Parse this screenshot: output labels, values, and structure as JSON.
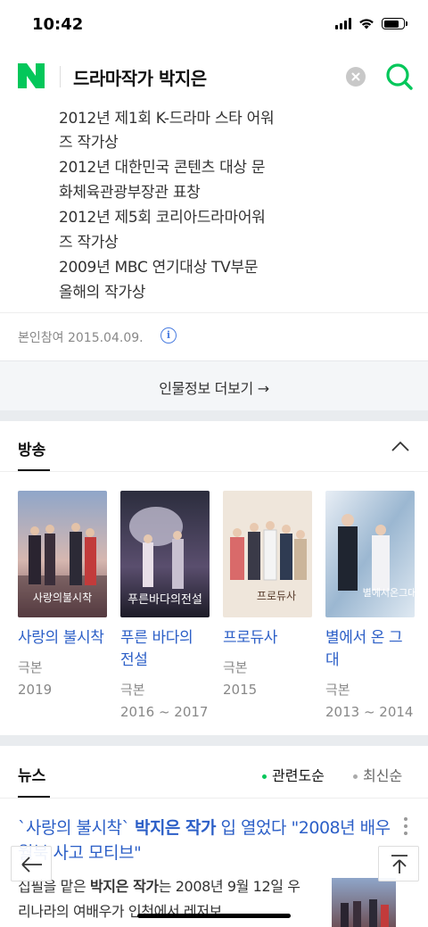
{
  "status": {
    "time": "10:42"
  },
  "search": {
    "query": "드라마작가 박지은"
  },
  "awards": [
    "2012년 제1회 K-드라마 스타 어워",
    "즈 작가상",
    "2012년 대한민국 콘텐츠 대상 문",
    "화체육관광부장관 표창",
    "2012년 제5회 코리아드라마어워",
    "즈 작가상",
    "2009년 MBC 연기대상 TV부문",
    "올해의 작가상"
  ],
  "reference": {
    "text": "본인참여 2015.04.09."
  },
  "more": {
    "label": "인물정보 더보기 →"
  },
  "broadcast": {
    "title": "방송",
    "dramas": [
      {
        "title": "사랑의 불시착",
        "role": "극본",
        "years": "2019"
      },
      {
        "title": "푸른 바다의 전설",
        "role": "극본",
        "years": "2016 ~ 2017"
      },
      {
        "title": "프로듀사",
        "role": "극본",
        "years": "2015"
      },
      {
        "title": "별에서 온 그대",
        "role": "극본",
        "years": "2013 ~ 2014"
      }
    ]
  },
  "news": {
    "title": "뉴스",
    "sort_relevance": "관련도순",
    "sort_latest": "최신순",
    "headline_pre": "`사랑의 불시착` ",
    "headline_bold": "박지은 작가",
    "headline_post": " 입 열었다 \"2008년 배우 월북 사고 모티브\"",
    "body_pre": "집필을 맡은 ",
    "body_bold": "박지은 작가",
    "body_post": "는 2008년 9월 12일 우리나라의 여배우가 인천에서 레저보"
  },
  "colors": {
    "brand": "#03c75a",
    "link": "#2c5fc7",
    "accent_line": "#9be3b8"
  },
  "icons": {
    "logo": "naver-logo",
    "clear": "clear-icon",
    "search": "search-icon",
    "info": "info-icon",
    "collapse": "chevron-up-icon",
    "back": "back-arrow-icon",
    "top": "scroll-top-icon"
  }
}
